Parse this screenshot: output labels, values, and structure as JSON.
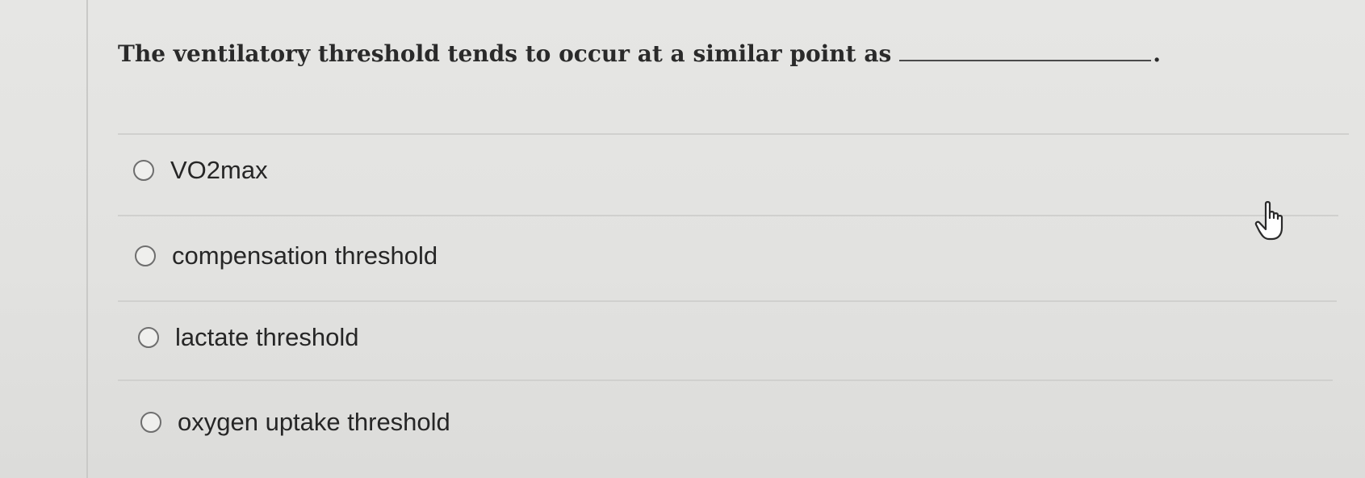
{
  "question": {
    "text": "The ventilatory threshold tends to occur at a similar point as",
    "period": "."
  },
  "options": [
    {
      "label": "VO2max",
      "selected": false
    },
    {
      "label": "compensation threshold",
      "selected": false
    },
    {
      "label": "lactate threshold",
      "selected": false
    },
    {
      "label": "oxygen uptake threshold",
      "selected": false
    }
  ],
  "cursor": {
    "icon": "hand-pointer-icon"
  }
}
